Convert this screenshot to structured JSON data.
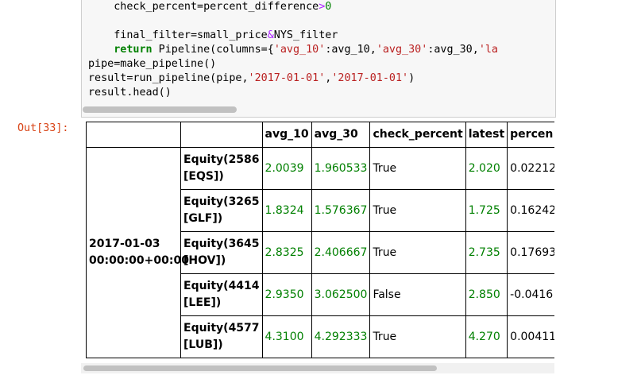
{
  "code": {
    "line1": {
      "pre": "    check_percent=percent_difference",
      "op": ">",
      "num": "0"
    },
    "line3": {
      "pre": "    final_filter=small_price",
      "op": "&",
      "post": "NYS_filter"
    },
    "line4": {
      "indent": "    ",
      "kw": "return",
      "mid": " Pipeline(columns={",
      "s1": "'avg_10'",
      "m2": ":avg_10,",
      "s2": "'avg_30'",
      "m3": ":avg_30,",
      "s3": "'la"
    },
    "line5": "pipe=make_pipeline()",
    "line6": {
      "pre": "result=run_pipeline(pipe,",
      "s1": "'2017-01-01'",
      "sep": ",",
      "s2": "'2017-01-01'",
      "post": ")"
    },
    "line7": "result.head()"
  },
  "output": {
    "prompt": "Out[33]:",
    "columns": [
      "avg_10",
      "avg_30",
      "check_percent",
      "latest",
      "percen"
    ],
    "date_index": "2017-01-03 00:00:00+00:00",
    "rows": [
      {
        "equity_line1": "Equity(2586",
        "equity_line2": "[EQS])",
        "avg_10": "2.0039",
        "avg_30": "1.960533",
        "check_percent": "True",
        "latest": "2.020",
        "percent": "0.02212"
      },
      {
        "equity_line1": "Equity(3265",
        "equity_line2": "[GLF])",
        "avg_10": "1.8324",
        "avg_30": "1.576367",
        "check_percent": "True",
        "latest": "1.725",
        "percent": "0.16242"
      },
      {
        "equity_line1": "Equity(3645",
        "equity_line2": "[HOV])",
        "avg_10": "2.8325",
        "avg_30": "2.406667",
        "check_percent": "True",
        "latest": "2.735",
        "percent": "0.17693"
      },
      {
        "equity_line1": "Equity(4414",
        "equity_line2": "[LEE])",
        "avg_10": "2.9350",
        "avg_30": "3.062500",
        "check_percent": "False",
        "latest": "2.850",
        "percent": "-0.0416"
      },
      {
        "equity_line1": "Equity(4577",
        "equity_line2": "[LUB])",
        "avg_10": "4.3100",
        "avg_30": "4.292333",
        "check_percent": "True",
        "latest": "4.270",
        "percent": "0.00411"
      }
    ]
  }
}
